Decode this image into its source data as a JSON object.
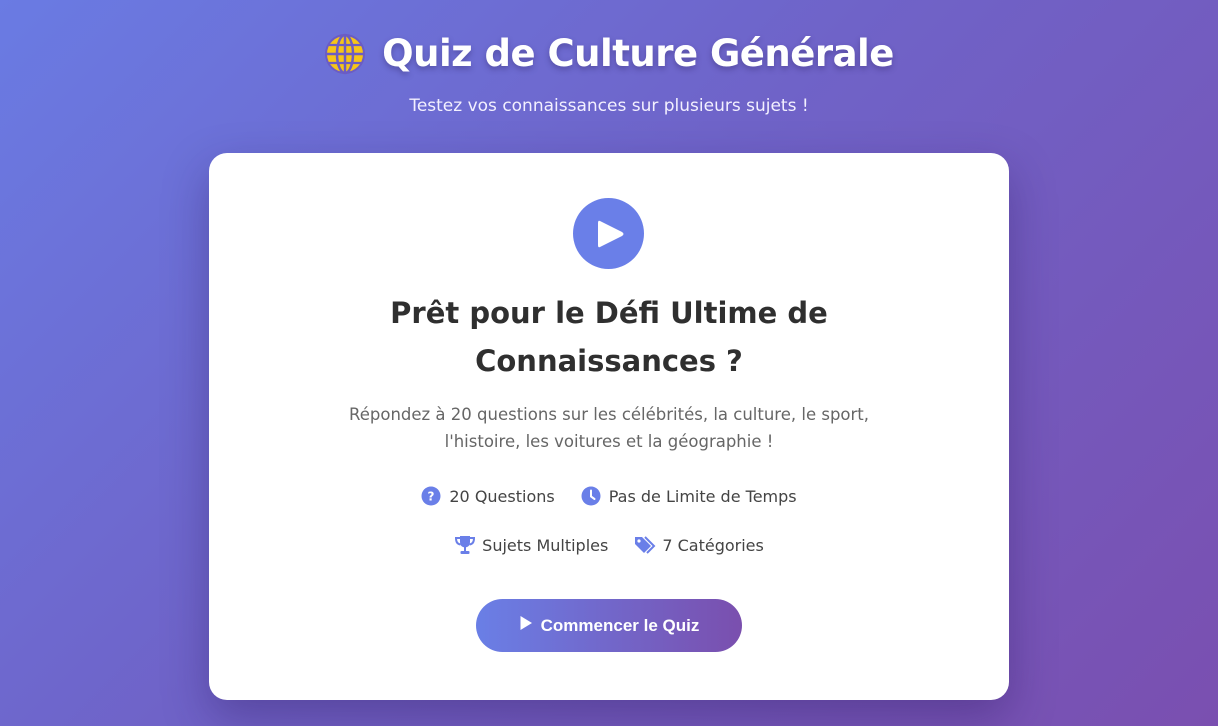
{
  "header": {
    "title": "Quiz de Culture Générale",
    "subtitle": "Testez vos connaissances sur plusieurs sujets !",
    "icon": "globe-icon"
  },
  "card": {
    "icon": "play-icon",
    "title_line1": "Prêt pour le Défi Ultime de",
    "title_line2": "Connaissances ?",
    "description": "Répondez à 20 questions sur les célébrités, la culture, le sport, l'histoire, les voitures et la géographie !",
    "features": [
      {
        "icon": "question-circle-icon",
        "label": "20 Questions"
      },
      {
        "icon": "clock-icon",
        "label": "Pas de Limite de Temps"
      },
      {
        "icon": "trophy-icon",
        "label": "Sujets Multiples"
      },
      {
        "icon": "tags-icon",
        "label": "7 Catégories"
      }
    ],
    "start_button": {
      "label": "Commencer le Quiz",
      "icon": "play-icon"
    }
  },
  "colors": {
    "accent": "#6a7fe8",
    "globe": "#f5c518",
    "gradient_start": "#6a7be3",
    "gradient_end": "#7a4fb0"
  }
}
